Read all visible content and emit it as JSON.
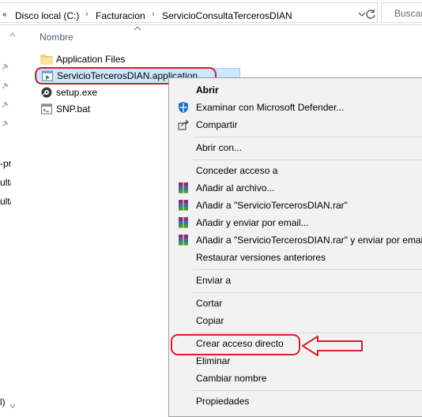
{
  "address_bar": {
    "back_glyph": "«",
    "breadcrumbs": [
      "Disco local (C:)",
      "Facturacion",
      "ServicioConsultaTercerosDIAN"
    ],
    "separator": "›",
    "search_placeholder": "Buscar"
  },
  "nav_pane": {
    "truncated_labels": [
      "-pr",
      "ulta",
      "ulta",
      "l)"
    ]
  },
  "file_list": {
    "column_header": "Nombre",
    "items": [
      {
        "name": "Application Files",
        "icon": "folder-icon",
        "selected": false
      },
      {
        "name": "ServicioTercerosDIAN.application",
        "icon": "application-manifest-icon",
        "selected": true
      },
      {
        "name": "setup.exe",
        "icon": "setup-exe-icon",
        "selected": false
      },
      {
        "name": "SNP.bat",
        "icon": "batch-file-icon",
        "selected": false
      }
    ]
  },
  "context_menu": {
    "items": [
      {
        "label": "Abrir",
        "bold": true,
        "icon": null
      },
      {
        "label": "Examinar con Microsoft Defender...",
        "icon": "defender-icon"
      },
      {
        "label": "Compartir",
        "icon": "share-icon"
      },
      {
        "label": "Abrir con...",
        "icon": null
      },
      {
        "label": "Conceder acceso a",
        "icon": null
      },
      {
        "label": "Añadir al archivo...",
        "icon": "winrar-icon"
      },
      {
        "label": "Añadir a \"ServicioTercerosDIAN.rar\"",
        "icon": "winrar-icon"
      },
      {
        "label": "Añadir y enviar por email...",
        "icon": "winrar-icon"
      },
      {
        "label": "Añadir a \"ServicioTercerosDIAN.rar\" y enviar por email",
        "icon": "winrar-icon"
      },
      {
        "label": "Restaurar versiones anteriores",
        "icon": null
      },
      {
        "label": "Enviar a",
        "icon": null
      },
      {
        "label": "Cortar",
        "icon": null
      },
      {
        "label": "Copiar",
        "icon": null
      },
      {
        "label": "Crear acceso directo",
        "icon": null
      },
      {
        "label": "Eliminar",
        "icon": null
      },
      {
        "label": "Cambiar nombre",
        "icon": null
      },
      {
        "label": "Propiedades",
        "icon": null
      }
    ]
  },
  "colors": {
    "selection_bg": "#cce8ff",
    "menu_bg": "#f2f2f2",
    "annotation_red": "#d0222e",
    "header_text": "#4c607a"
  }
}
